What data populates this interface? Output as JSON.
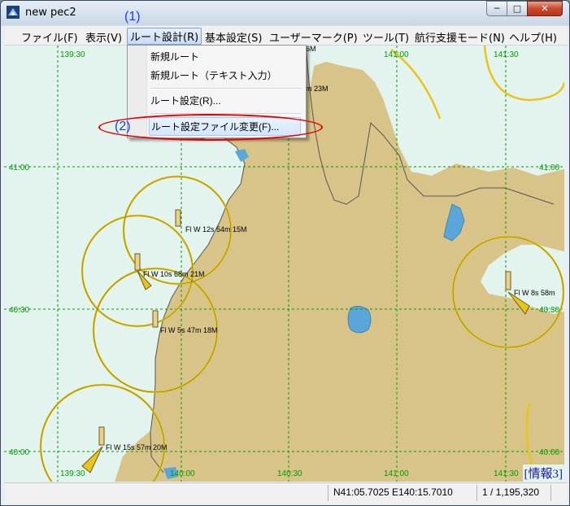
{
  "window": {
    "title": "new pec2",
    "min_glyph": "─",
    "max_glyph": "□",
    "close_glyph": "✕"
  },
  "menu": {
    "items": [
      "ファイル(F)",
      "表示(V)",
      "ルート設計(R)",
      "基本設定(S)",
      "ユーザーマーク(P)",
      "ツール(T)",
      "航行支援モード(N)",
      "ヘルプ(H)"
    ],
    "active_index": 2
  },
  "annotations": {
    "step1": "(1)",
    "step2": "(2)"
  },
  "dropdown": {
    "new_route": "新規ルート",
    "new_route_text": "新規ルート（テキスト入力）",
    "route_settings": "ルート設定(R)...",
    "route_file_change": "ルート設定ファイル変更(F)..."
  },
  "map": {
    "grid_labels": {
      "lon_139_30": "139:30",
      "lon_140_00": "140:00",
      "lon_140_30": "140:30",
      "lon_141_00": "141:00",
      "lon_141_30": "141:30",
      "lat_41_00": "41:00",
      "lat_40_30": "40:30",
      "lat_40_00": "40:00"
    },
    "lights": [
      "Fl W 12s 54m 15M",
      "Fl W 10s 68m 21M",
      "Fl W 5s 47m 18M",
      "Fl W 15s 57m 20M",
      "Fl W 8s 58m",
      "m 23M",
      "6M"
    ],
    "info_label": "[情報3]",
    "colors": {
      "sea": "#e3f4ee",
      "land": "#d8c489",
      "lake": "#5aa6d8",
      "grid": "#009a00",
      "range_ring": "#e6c619"
    }
  },
  "status": {
    "coords": "N41:05.7025 E140:15.7010",
    "scale": "1 / 1,195,320"
  }
}
